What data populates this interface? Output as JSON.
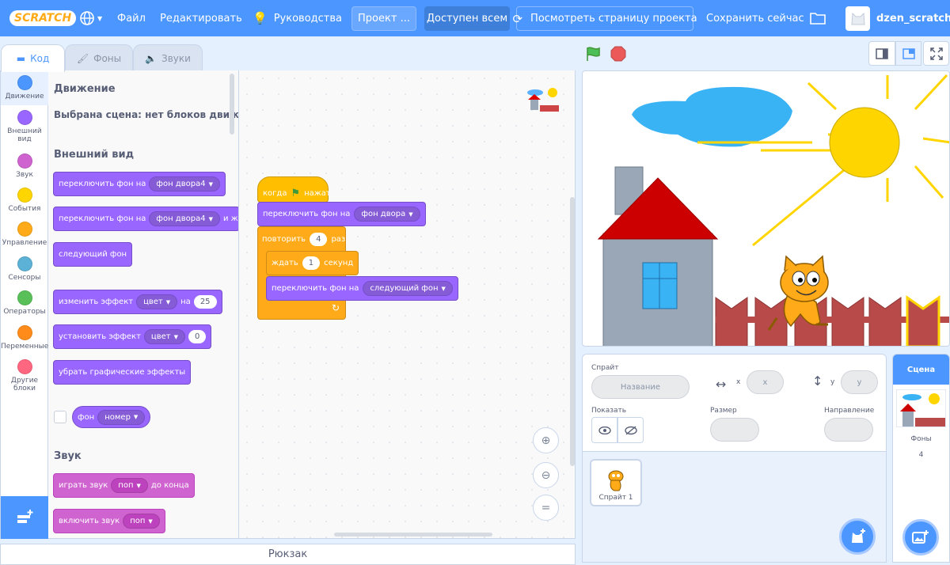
{
  "menubar": {
    "logo": "SCRATCH",
    "file": "Файл",
    "edit": "Редактировать",
    "tutorials": "Руководства",
    "project_title": "Проект ...",
    "share": "Доступен всем",
    "see_project_page": "Посмотреть страницу проекта",
    "save_now": "Сохранить сейчас",
    "username": "dzen_scratch"
  },
  "tabs": {
    "code": "Код",
    "backdrops": "Фоны",
    "sounds": "Звуки"
  },
  "categories": [
    {
      "label": "Движение",
      "color": "#4c97ff"
    },
    {
      "label": "Внешний вид",
      "color": "#9966ff"
    },
    {
      "label": "Звук",
      "color": "#cf63cf"
    },
    {
      "label": "События",
      "color": "#ffd500"
    },
    {
      "label": "Управление",
      "color": "#ffab19"
    },
    {
      "label": "Сенсоры",
      "color": "#5cb1d6"
    },
    {
      "label": "Операторы",
      "color": "#59c059"
    },
    {
      "label": "Переменные",
      "color": "#ff8c1a"
    },
    {
      "label": "Другие блоки",
      "color": "#ff6680"
    }
  ],
  "palette": {
    "motion_heading": "Движение",
    "motion_note": "Выбрана сцена: нет блоков движени",
    "looks_heading": "Внешний вид",
    "switch_backdrop_to": "переключить фон на",
    "backdrop_value": "фон двора4",
    "and_wait": "и ждат",
    "next_backdrop": "следующий фон",
    "change_effect": "изменить эффект",
    "effect_color": "цвет",
    "by": "на",
    "change_value": "25",
    "set_effect": "установить эффект",
    "set_value": "0",
    "clear_effects": "убрать графические эффекты",
    "backdrop_reporter": "фон",
    "number_option": "номер",
    "sound_heading": "Звук",
    "play_sound": "играть звук",
    "sound_value": "поп",
    "until_done": "до конца",
    "start_sound": "включить звук"
  },
  "script": {
    "when_flag": "когда",
    "clicked": "нажат",
    "switch_to": "переключить фон на",
    "switch_value": "фон двора",
    "repeat": "повторить",
    "repeat_count": "4",
    "times": "раз",
    "wait": "ждать",
    "wait_value": "1",
    "seconds": "секунд",
    "switch_to_2": "переключить фон на",
    "next_value": "следующий фон"
  },
  "sprite_info": {
    "sprite_label": "Спрайт",
    "name_placeholder": "Название",
    "x_label": "x",
    "x_value": "x",
    "y_label": "y",
    "y_value": "y",
    "show_label": "Показать",
    "size_label": "Размер",
    "direction_label": "Направление"
  },
  "sprite_list": {
    "sprite1": "Спрайт 1"
  },
  "stage_panel": {
    "title": "Сцена",
    "backdrops_label": "Фоны",
    "backdrops_count": "4"
  },
  "backpack": "Рюкзак",
  "colors": {
    "accent": "#4c97ff",
    "motion": "#4c97ff",
    "looks": "#9966ff",
    "control": "#ffab19",
    "events": "#ffbf00"
  }
}
